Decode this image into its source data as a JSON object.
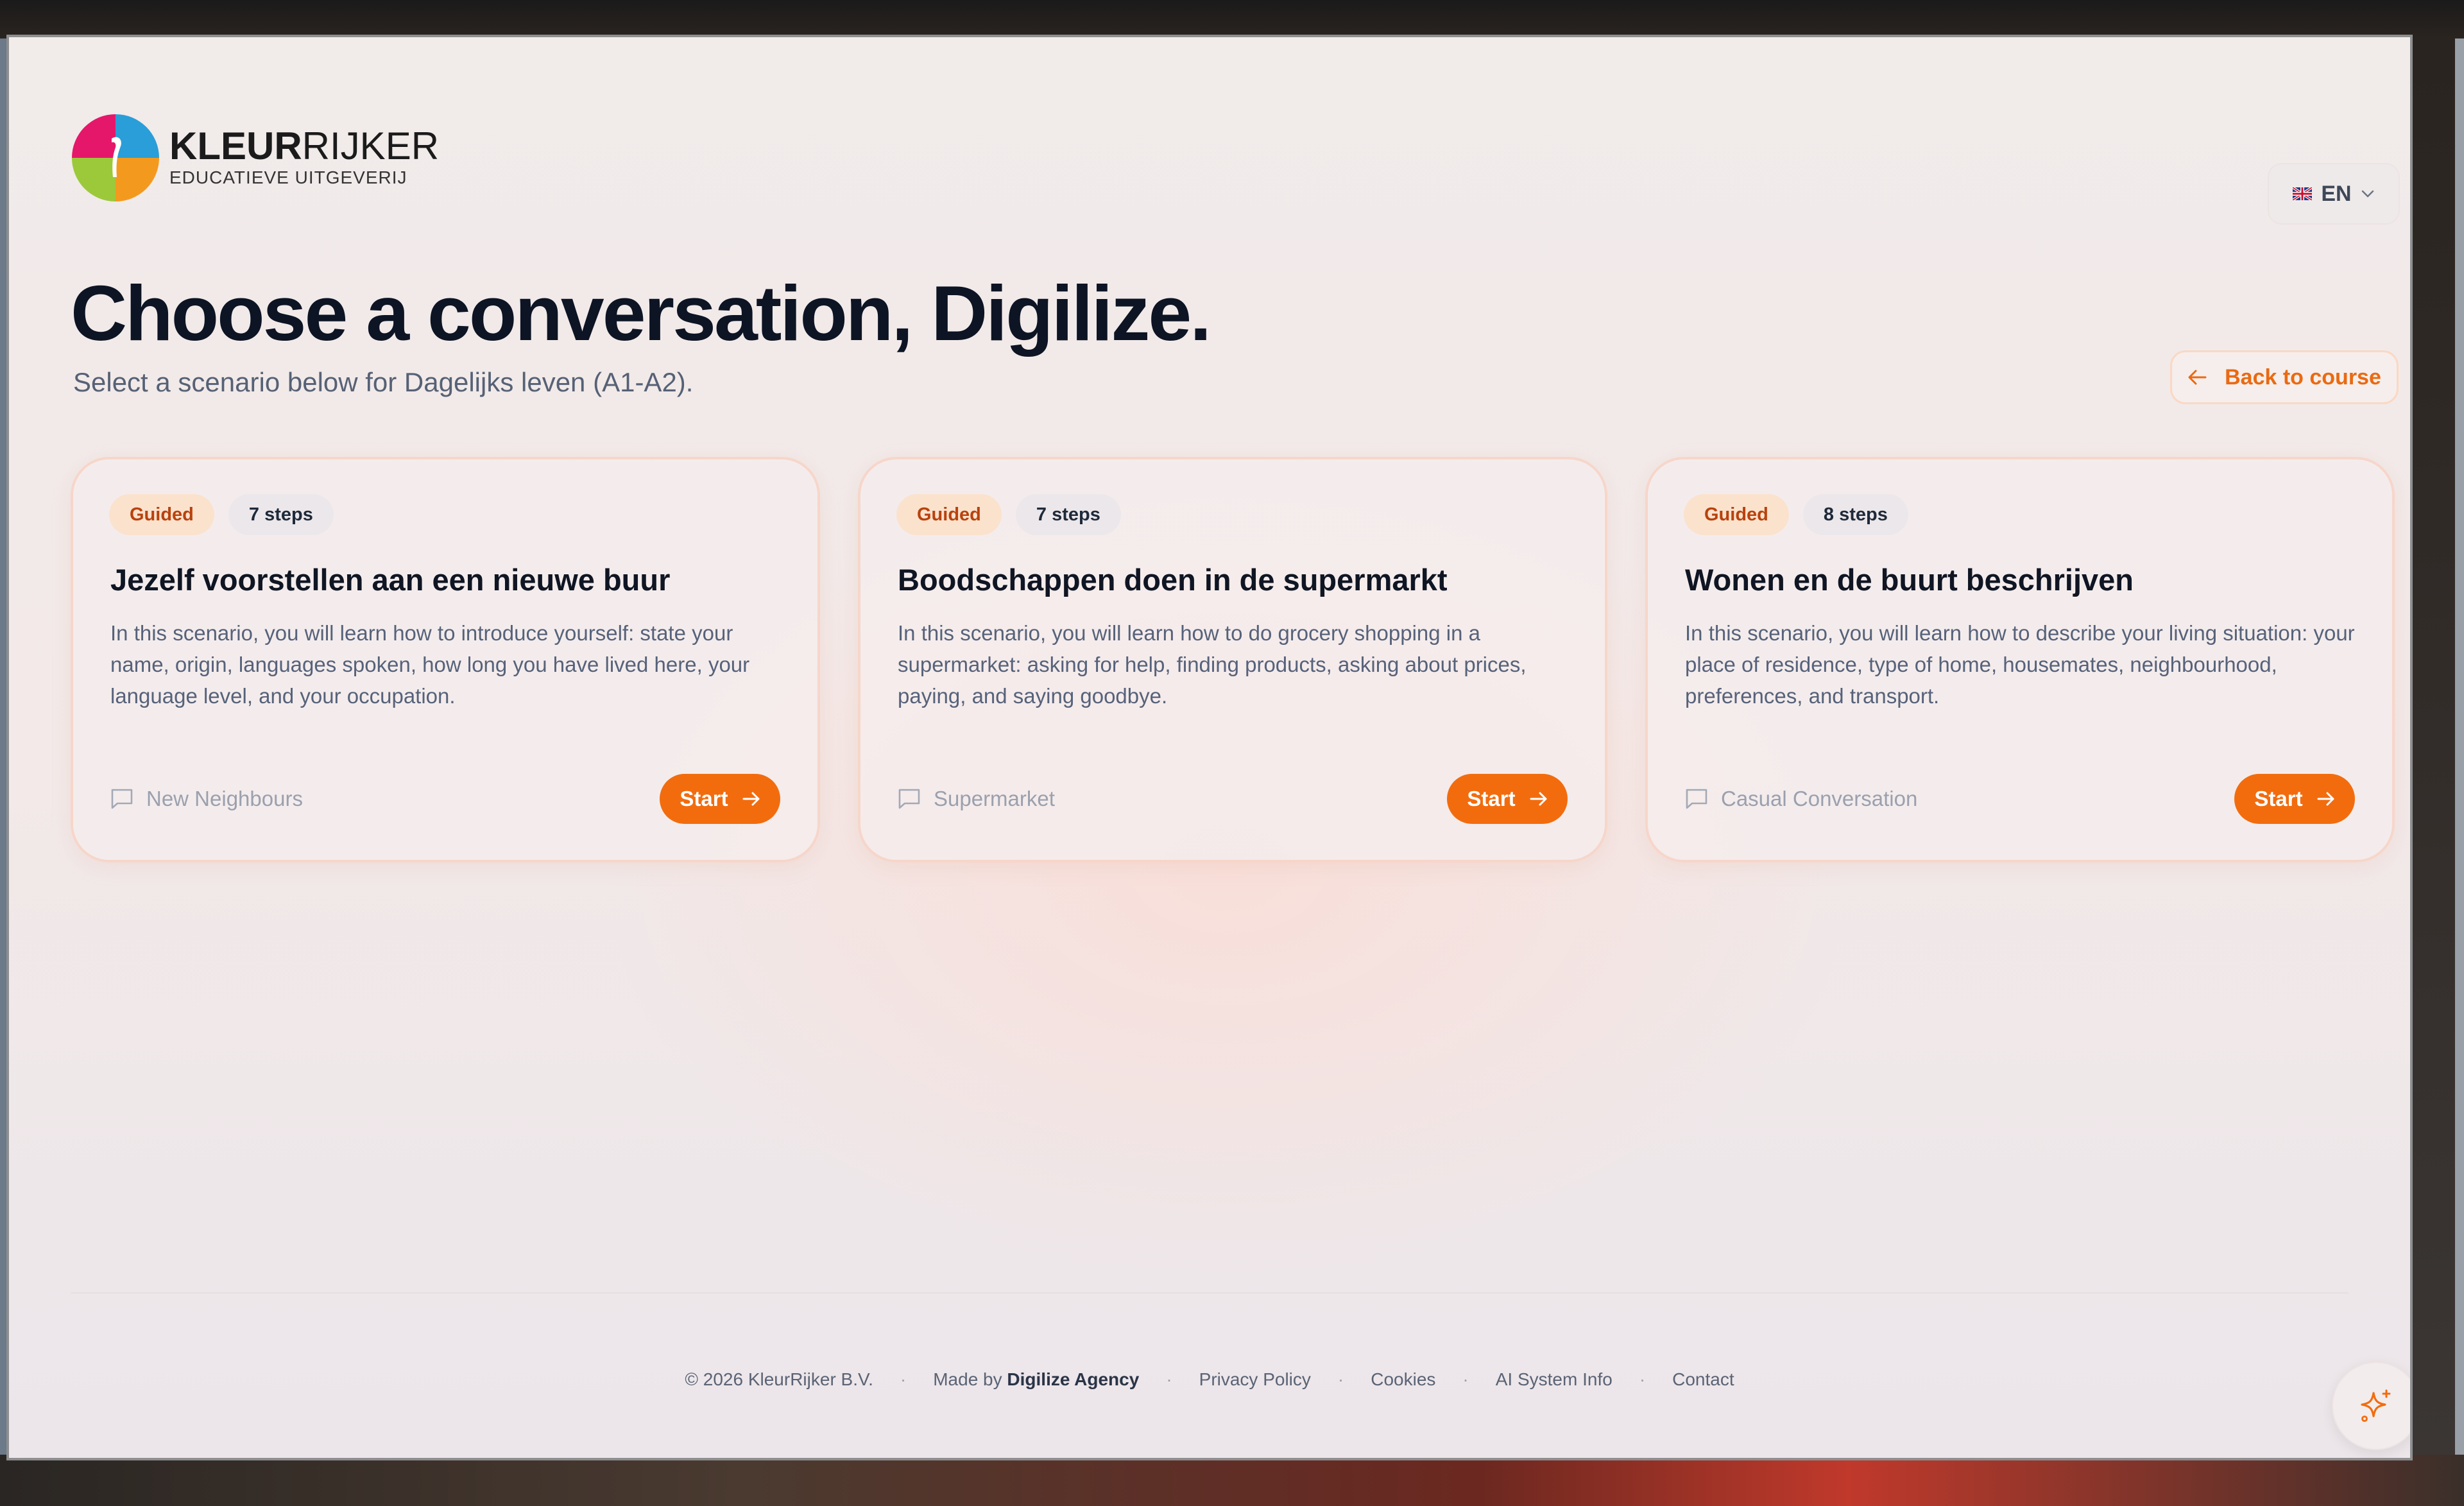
{
  "brand": {
    "name_bold": "KLEUR",
    "name_light": "RIJKER",
    "tagline": "EDUCATIEVE UITGEVERIJ",
    "colors": {
      "accent": "#f26c0e",
      "accent_text": "#ea6a12"
    }
  },
  "language": {
    "code": "EN",
    "flag": "uk-flag-icon"
  },
  "header": {
    "title": "Choose a conversation, Digilize.",
    "subtitle": "Select a scenario below for Dagelijks leven (A1-A2).",
    "back_label": "Back to course"
  },
  "scenarios": [
    {
      "mode": "Guided",
      "steps": "7 steps",
      "title": "Jezelf voorstellen aan een nieuwe buur",
      "description": "In this scenario, you will learn how to introduce yourself: state your name, origin, languages spoken, how long you have lived here, your language level, and your occupation.",
      "category": "New Neighbours",
      "start_label": "Start"
    },
    {
      "mode": "Guided",
      "steps": "7 steps",
      "title": "Boodschappen doen in de supermarkt",
      "description": "In this scenario, you will learn how to do grocery shopping in a supermarket: asking for help, finding products, asking about prices, paying, and saying goodbye.",
      "category": "Supermarket",
      "start_label": "Start"
    },
    {
      "mode": "Guided",
      "steps": "8 steps",
      "title": "Wonen en de buurt beschrijven",
      "description": "In this scenario, you will learn how to describe your living situation: your place of residence, type of home, housemates, neighbourhood, preferences, and transport.",
      "category": "Casual Conversation",
      "start_label": "Start"
    }
  ],
  "footer": {
    "copyright": "© 2026 KleurRijker B.V.",
    "made_by_prefix": "Made by",
    "made_by_name": "Digilize Agency",
    "privacy": "Privacy Policy",
    "cookies": "Cookies",
    "ai_info": "AI System Info",
    "contact": "Contact",
    "separator": "·"
  }
}
